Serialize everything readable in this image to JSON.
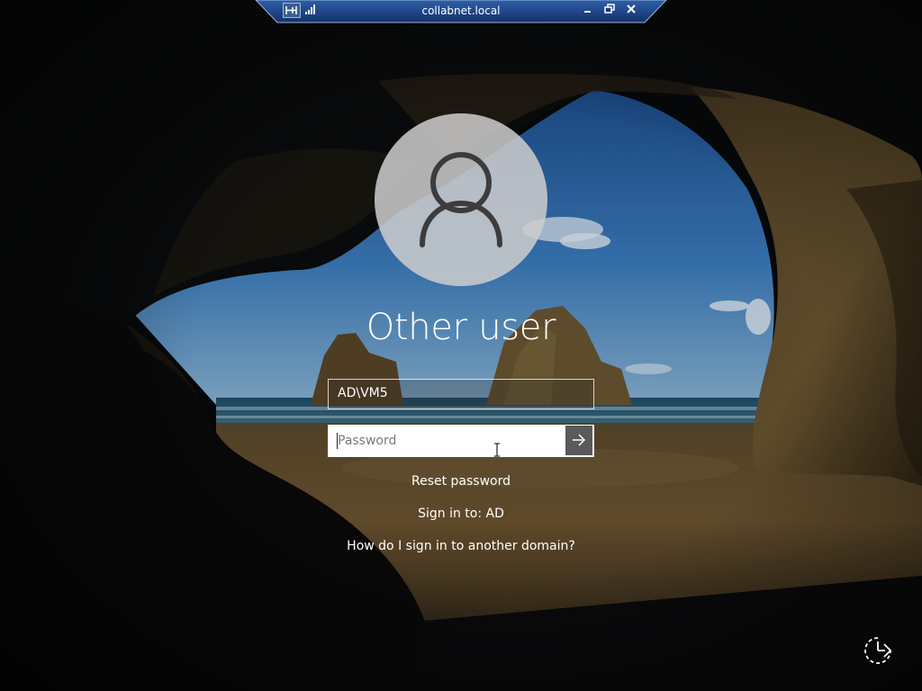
{
  "rdp_bar": {
    "title": "collabnet.local",
    "pin_icon": "pin-icon",
    "signal_icon": "signal-strength-icon",
    "minimize_icon": "minimize-icon",
    "restore_icon": "restore-icon",
    "close_icon": "close-icon",
    "bar_color": "#1c3f7a"
  },
  "login": {
    "avatar_icon": "user-silhouette-icon",
    "heading": "Other user",
    "username_value": "AD\\VM5",
    "password_placeholder": "Password",
    "submit_icon": "arrow-right-icon",
    "reset_password_label": "Reset password",
    "sign_in_to_label": "Sign in to: AD",
    "other_domain_label": "How do I sign in to another domain?"
  },
  "corner": {
    "accessibility_icon": "ease-of-access-icon"
  }
}
